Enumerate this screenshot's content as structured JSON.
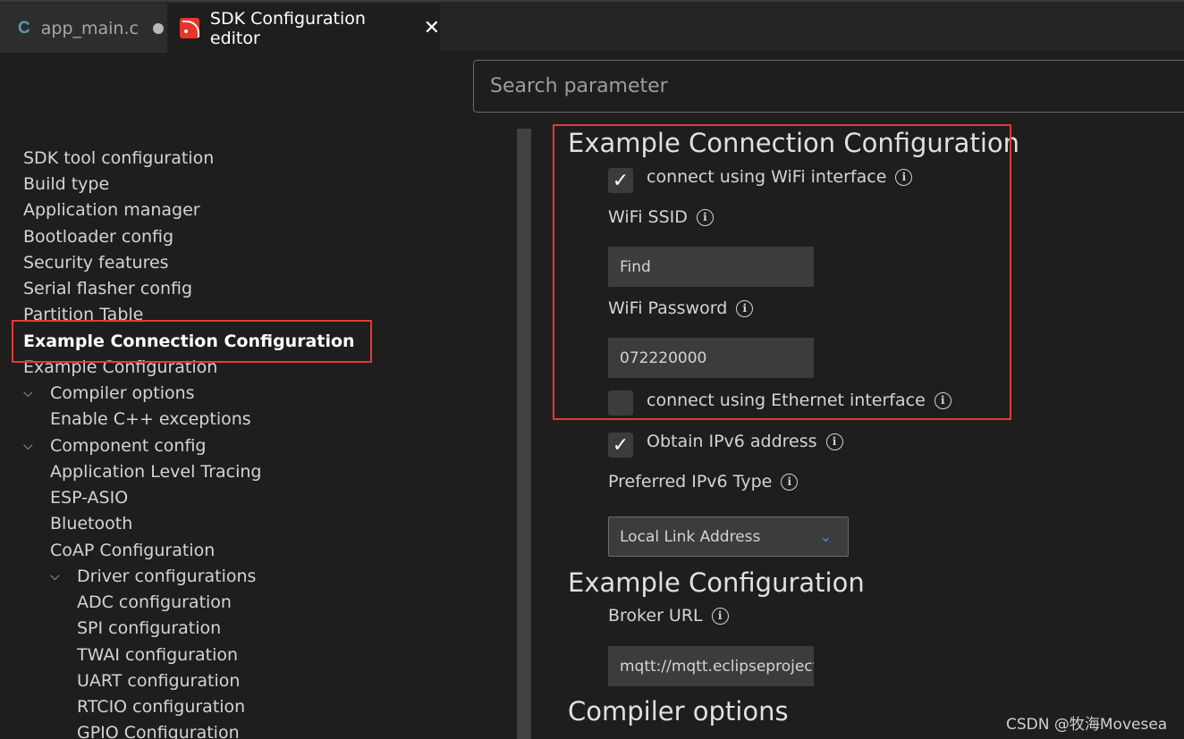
{
  "tabs": [
    {
      "icon": "C",
      "label": "app_main.c"
    },
    {
      "label": "SDK Configuration editor",
      "close": "✕"
    }
  ],
  "search": {
    "placeholder": "Search parameter"
  },
  "sidebar": {
    "items": [
      "SDK tool configuration",
      "Build type",
      "Application manager",
      "Bootloader config",
      "Security features",
      "Serial flasher config",
      "Partition Table",
      "Example Connection Configuration",
      "Example Configuration",
      "Compiler options",
      "Enable C++ exceptions",
      "Component config",
      "Application Level Tracing",
      "ESP-ASIO",
      "Bluetooth",
      "CoAP Configuration",
      "Driver configurations",
      "ADC configuration",
      "SPI configuration",
      "TWAI configuration",
      "UART configuration",
      "RTCIO configuration",
      "GPIO Configuration"
    ],
    "selected": "Example Connection Configuration"
  },
  "main": {
    "section1": {
      "title": "Example Connection Configuration",
      "wifi_checkbox": {
        "label": "connect using WiFi interface",
        "checked": true
      },
      "ssid": {
        "label": "WiFi SSID",
        "value": "Find"
      },
      "password": {
        "label": "WiFi Password",
        "value": "072220000"
      },
      "eth_checkbox": {
        "label": "connect using Ethernet interface",
        "checked": false
      },
      "ipv6_checkbox": {
        "label": "Obtain IPv6 address",
        "checked": true
      },
      "ipv6_type": {
        "label": "Preferred IPv6 Type",
        "value": "Local Link Address"
      }
    },
    "section2": {
      "title": "Example Configuration",
      "broker": {
        "label": "Broker URL",
        "value": "mqtt://mqtt.eclipseprojects.io"
      }
    },
    "section3": {
      "title": "Compiler options"
    }
  },
  "glyphs": {
    "check": "✓",
    "info": "i",
    "chevron_down": "⌵",
    "caret": "⌄"
  },
  "colors": {
    "highlight_border": "#e53935",
    "accent": "#3794ff"
  },
  "watermark": "CSDN @牧海Movesea"
}
